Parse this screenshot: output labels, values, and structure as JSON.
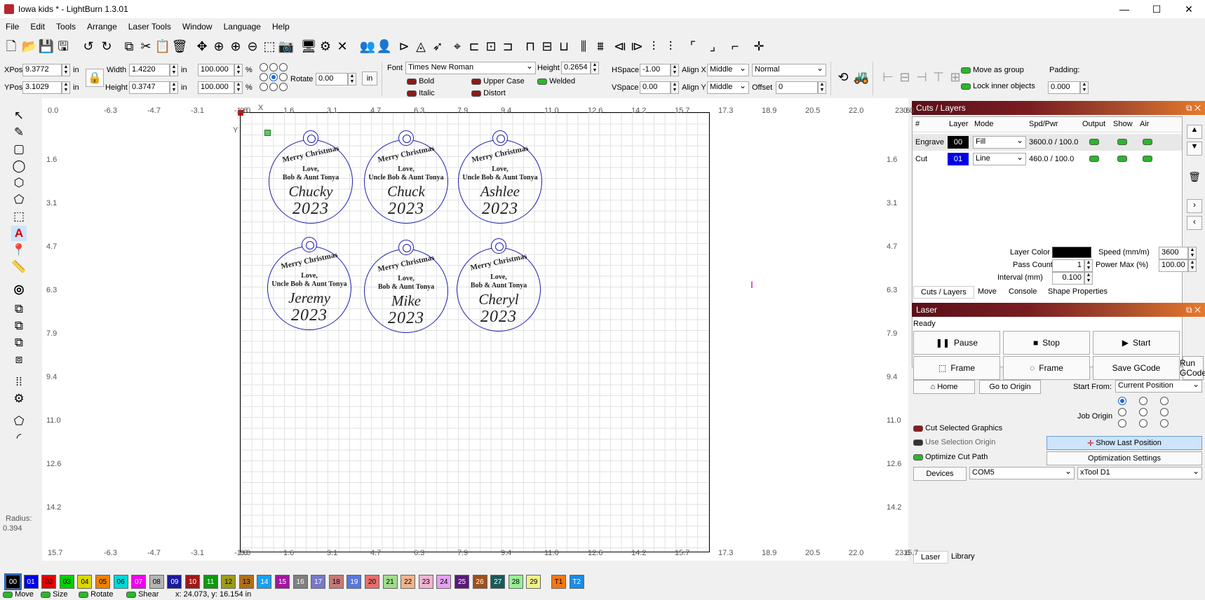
{
  "window": {
    "title": "Iowa kids * - LightBurn 1.3.01",
    "minimize": "—",
    "maximize": "☐",
    "close": "✕"
  },
  "menu": [
    "File",
    "Edit",
    "Tools",
    "Arrange",
    "Laser Tools",
    "Window",
    "Language",
    "Help"
  ],
  "toolbar_icons": [
    "new-file",
    "open",
    "save",
    "save-as",
    "undo",
    "redo",
    "copy",
    "cut",
    "paste",
    "delete",
    "move",
    "zoom-in",
    "zoom-in-alt",
    "zoom-out",
    "zoom-frame",
    "camera",
    "monitor",
    "settings",
    "tools",
    "group-users",
    "user",
    "mirror-h",
    "mirror-v",
    "send",
    "center",
    "align-left",
    "align-center",
    "align-right",
    "align-top",
    "align-middle",
    "align-bottom",
    "distribute-h",
    "distribute-v",
    "distribute-hc",
    "distribute-vc",
    "dock-left",
    "dock-right",
    "move-to-laser",
    "jog-target"
  ],
  "position": {
    "xpos_label": "XPos",
    "xpos": "9.3772",
    "ypos_label": "YPos",
    "ypos": "3.1029",
    "unit": "in",
    "width_label": "Width",
    "width": "1.4220",
    "height_label": "Height",
    "height": "0.3747",
    "scale_w": "100.000",
    "scale_h": "100.000",
    "percent": "%",
    "rotate_label": "Rotate",
    "rotate": "0.00",
    "in_button": "in"
  },
  "text_tools": {
    "font_label": "Font",
    "font": "Times New Roman",
    "height_label": "Height",
    "height": "0.2654",
    "hspace_label": "HSpace",
    "hspace": "-1.00",
    "vspace_label": "VSpace",
    "vspace": "0.00",
    "alignx_label": "Align X",
    "alignx": "Middle",
    "aligny_label": "Align Y",
    "aligny": "Middle",
    "style": "Normal",
    "offset_label": "Offset",
    "offset": "0",
    "bold": "Bold",
    "italic": "Italic",
    "upper_case": "Upper Case",
    "distort": "Distort",
    "welded": "Welded"
  },
  "group_opts": {
    "move_as_group": "Move as group",
    "lock_inner": "Lock inner objects",
    "padding_label": "Padding:",
    "padding": "0.000"
  },
  "left_tools": {
    "radius_label": "Radius:",
    "radius": "0.394"
  },
  "ruler": {
    "top": [
      "0.0",
      "-6.3",
      "-4.7",
      "-3.1",
      "-1.6",
      "0.0",
      "1.6",
      "3.1",
      "4.7",
      "6.3",
      "7.9",
      "9.4",
      "11.0",
      "12.6",
      "14.2",
      "15.7",
      "17.3",
      "18.9",
      "20.5",
      "22.0",
      "23.6",
      "0.0"
    ],
    "bottom": [
      "15.7",
      "-6.3",
      "-4.7",
      "-3.1",
      "-1.6",
      "0.0",
      "1.6",
      "3.1",
      "4.7",
      "6.3",
      "7.9",
      "9.4",
      "11.0",
      "12.6",
      "14.2",
      "15.7",
      "17.3",
      "18.9",
      "20.5",
      "22.0",
      "23.6",
      "15.7"
    ],
    "left": [
      "1.6",
      "3.1",
      "4.7",
      "6.3",
      "7.9",
      "9.4",
      "11.0",
      "12.6",
      "14.2"
    ],
    "right": [
      "1.6",
      "3.1",
      "4.7",
      "6.3",
      "7.9",
      "9.4",
      "11.0",
      "12.6",
      "14.2"
    ],
    "x_axis": "X",
    "y_axis": "Y"
  },
  "ornaments": [
    {
      "mc": "Merry Christmas",
      "love": "Love,",
      "from": "Bob & Aunt Tonya",
      "name": "Chucky",
      "year": "2023"
    },
    {
      "mc": "Merry Christmas",
      "love": "Love,",
      "from": "Uncle Bob & Aunt Tonya",
      "name": "Chuck",
      "year": "2023"
    },
    {
      "mc": "Merry Christmas",
      "love": "Love,",
      "from": "Uncle Bob & Aunt Tonya",
      "name": "Ashlee",
      "year": "2023"
    },
    {
      "mc": "Merry Christmas",
      "love": "Love,",
      "from": "Uncle Bob & Aunt Tonya",
      "name": "Jeremy",
      "year": "2023"
    },
    {
      "mc": "Merry Christmas",
      "love": "Love,",
      "from": "Bob & Aunt Tonya",
      "name": "Mike",
      "year": "2023"
    },
    {
      "mc": "Merry Christmas",
      "love": "Love,",
      "from": "Bob & Aunt Tonya",
      "name": "Cheryl",
      "year": "2023"
    }
  ],
  "cuts": {
    "title": "Cuts / Layers",
    "headers": [
      "#",
      "Layer",
      "Mode",
      "Spd/Pwr",
      "Output",
      "Show",
      "Air"
    ],
    "rows": [
      {
        "name": "Engrave",
        "layer": "00",
        "layer_color": "#000000",
        "mode": "Fill",
        "spdpwr": "3600.0 / 100.0"
      },
      {
        "name": "Cut",
        "layer": "01",
        "layer_color": "#0000e6",
        "mode": "Line",
        "spdpwr": "460.0 / 100.0"
      }
    ],
    "layer_color_label": "Layer Color",
    "speed_label": "Speed (mm/m)",
    "speed": "3600",
    "pass_label": "Pass Count",
    "pass": "1",
    "powermax_label": "Power Max (%)",
    "powermax": "100.00",
    "interval_label": "Interval (mm)",
    "interval": "0.100",
    "tabs": [
      "Cuts / Layers",
      "Move",
      "Console",
      "Shape Properties"
    ]
  },
  "laser": {
    "title": "Laser",
    "status": "Ready",
    "pause": "Pause",
    "stop": "Stop",
    "start": "Start",
    "frame1": "Frame",
    "frame2": "Frame",
    "save_gcode": "Save GCode",
    "run_gcode": "Run GCode",
    "home": "Home",
    "go_origin": "Go to Origin",
    "start_from_label": "Start From:",
    "start_from": "Current Position",
    "job_origin_label": "Job Origin",
    "cut_selected": "Cut Selected Graphics",
    "use_sel_origin": "Use Selection Origin",
    "show_last": "Show Last Position",
    "optimize_cut": "Optimize Cut Path",
    "opt_settings": "Optimization Settings",
    "devices": "Devices",
    "port": "COM5",
    "device": "xTool D1",
    "tabs": [
      "Laser",
      "Library"
    ]
  },
  "palette": [
    {
      "label": "00",
      "color": "#000000",
      "text": "#ffffff"
    },
    {
      "label": "01",
      "color": "#0000e6",
      "text": "#ffffff"
    },
    {
      "label": "02",
      "color": "#e60000",
      "text": "#000000"
    },
    {
      "label": "03",
      "color": "#00d000",
      "text": "#000000"
    },
    {
      "label": "04",
      "color": "#d8d800",
      "text": "#000000"
    },
    {
      "label": "05",
      "color": "#f08000",
      "text": "#000000"
    },
    {
      "label": "06",
      "color": "#00d8d8",
      "text": "#000000"
    },
    {
      "label": "07",
      "color": "#f000f0",
      "text": "#ffffff"
    },
    {
      "label": "08",
      "color": "#b4b4b4",
      "text": "#000000"
    },
    {
      "label": "09",
      "color": "#1a1a9c",
      "text": "#ffffff"
    },
    {
      "label": "10",
      "color": "#a01818",
      "text": "#ffffff"
    },
    {
      "label": "11",
      "color": "#109810",
      "text": "#ffffff"
    },
    {
      "label": "12",
      "color": "#9c9c1a",
      "text": "#000000"
    },
    {
      "label": "13",
      "color": "#b07018",
      "text": "#000000"
    },
    {
      "label": "14",
      "color": "#1aa0f0",
      "text": "#ffffff"
    },
    {
      "label": "15",
      "color": "#a0189c",
      "text": "#ffffff"
    },
    {
      "label": "16",
      "color": "#808080",
      "text": "#ffffff"
    },
    {
      "label": "17",
      "color": "#7878c8",
      "text": "#ffffff"
    },
    {
      "label": "18",
      "color": "#c87878",
      "text": "#000000"
    },
    {
      "label": "19",
      "color": "#5a78dc",
      "text": "#ffffff"
    },
    {
      "label": "20",
      "color": "#e66e6e",
      "text": "#000000"
    },
    {
      "label": "21",
      "color": "#a0dc8c",
      "text": "#000000"
    },
    {
      "label": "22",
      "color": "#f0b48c",
      "text": "#000000"
    },
    {
      "label": "23",
      "color": "#f0b4d2",
      "text": "#000000"
    },
    {
      "label": "24",
      "color": "#e6a0f0",
      "text": "#000000"
    },
    {
      "label": "25",
      "color": "#5a1a78",
      "text": "#ffffff"
    },
    {
      "label": "26",
      "color": "#a0501a",
      "text": "#ffffff"
    },
    {
      "label": "27",
      "color": "#1a5a5a",
      "text": "#ffffff"
    },
    {
      "label": "28",
      "color": "#96f096",
      "text": "#000000"
    },
    {
      "label": "29",
      "color": "#f0f08c",
      "text": "#000000"
    },
    {
      "label": "T1",
      "color": "#f07814",
      "text": "#000000"
    },
    {
      "label": "T2",
      "color": "#1a8ce6",
      "text": "#ffffff"
    }
  ],
  "status": {
    "move": "Move",
    "size": "Size",
    "rotate": "Rotate",
    "shear": "Shear",
    "coords": "x: 24.073, y: 16.154 in"
  }
}
